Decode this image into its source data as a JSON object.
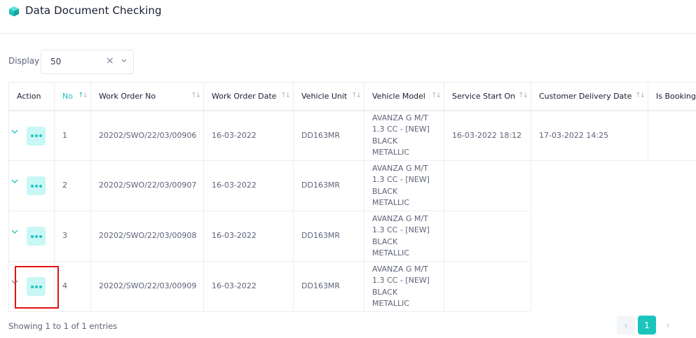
{
  "page": {
    "title": "Data Document Checking"
  },
  "display": {
    "label": "Display",
    "value": "50",
    "clear_glyph": "×"
  },
  "colors": {
    "accent": "#1bc5bd",
    "accent_light": "#c9f7f5",
    "highlight": "#e01414"
  },
  "table": {
    "headers": [
      {
        "label": "Action",
        "sortable": false
      },
      {
        "label": "No",
        "sortable": true,
        "sorted": "asc"
      },
      {
        "label": "Work Order No",
        "sortable": true
      },
      {
        "label": "Work Order Date",
        "sortable": true
      },
      {
        "label": "Vehicle Unit",
        "sortable": true
      },
      {
        "label": "Vehicle Model",
        "sortable": true
      },
      {
        "label": "Service Start On",
        "sortable": true
      },
      {
        "label": "Customer Delivery Date",
        "sortable": true
      },
      {
        "label": "Is Booking",
        "sortable": true
      }
    ],
    "rows": [
      {
        "no": "1",
        "work_order_no": "20202/SWO/22/03/00906",
        "work_order_date": "16-03-2022",
        "vehicle_unit": "DD163MR",
        "vehicle_model": "AVANZA G M/T 1.3 CC - [NEW] BLACK METALLIC",
        "service_start_on": "16-03-2022 18:12",
        "customer_delivery_date": "17-03-2022 14:25"
      },
      {
        "no": "2",
        "work_order_no": "20202/SWO/22/03/00907",
        "work_order_date": "16-03-2022",
        "vehicle_unit": "DD163MR",
        "vehicle_model": "AVANZA G M/T 1.3 CC - [NEW] BLACK METALLIC",
        "service_start_on": ""
      },
      {
        "no": "3",
        "work_order_no": "20202/SWO/22/03/00908",
        "work_order_date": "16-03-2022",
        "vehicle_unit": "DD163MR",
        "vehicle_model": "AVANZA G M/T 1.3 CC - [NEW] BLACK METALLIC",
        "service_start_on": ""
      },
      {
        "no": "4",
        "work_order_no": "20202/SWO/22/03/00909",
        "work_order_date": "16-03-2022",
        "vehicle_unit": "DD163MR",
        "vehicle_model": "AVANZA G M/T 1.3 CC - [NEW] BLACK METALLIC",
        "service_start_on": ""
      }
    ]
  },
  "footer": {
    "showing": "Showing 1 to 1 of 1 entries"
  },
  "pagination": {
    "prev": "‹",
    "current": "1",
    "next": "›"
  }
}
